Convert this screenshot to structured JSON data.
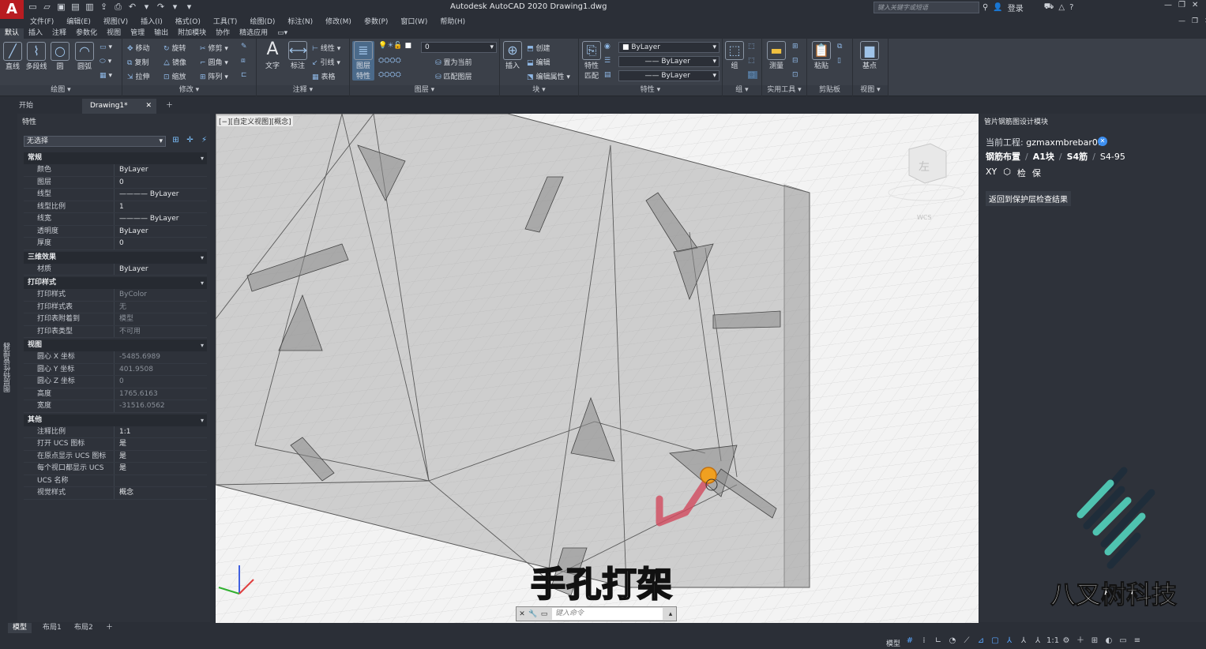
{
  "app": {
    "logo_letter": "A",
    "window_title": "Autodesk AutoCAD 2020   Drawing1.dwg",
    "search_placeholder": "键入关键字或短语",
    "login": "登录",
    "accent_color": "#b81c21"
  },
  "menu": [
    "文件(F)",
    "编辑(E)",
    "视图(V)",
    "插入(I)",
    "格式(O)",
    "工具(T)",
    "绘图(D)",
    "标注(N)",
    "修改(M)",
    "参数(P)",
    "窗口(W)",
    "帮助(H)"
  ],
  "ribbon_tabs": [
    "默认",
    "插入",
    "注释",
    "参数化",
    "视图",
    "管理",
    "输出",
    "附加模块",
    "协作",
    "精选应用"
  ],
  "ribbon": {
    "draw": {
      "title": "绘图",
      "line": "直线",
      "polyline": "多段线",
      "circle": "圆",
      "arc": "圆弧"
    },
    "modify": {
      "title": "修改",
      "move": "移动",
      "rotate": "旋转",
      "trim": "修剪",
      "copy": "复制",
      "mirror": "镜像",
      "fillet": "圆角",
      "stretch": "拉伸",
      "scale": "缩放",
      "array": "阵列"
    },
    "annotation": {
      "title": "注释",
      "text": "文字",
      "dimension": "标注",
      "linear": "线性",
      "leader": "引线",
      "table": "表格"
    },
    "layers": {
      "title": "图层",
      "properties": "图层\n特性",
      "layer_value": "0",
      "set_current": "置为当前",
      "match_layer": "匹配图层"
    },
    "block": {
      "title": "块",
      "insert": "插入",
      "create": "创建",
      "edit": "编辑",
      "edit_attr": "编辑属性"
    },
    "properties": {
      "title": "特性",
      "match": "特性\n匹配",
      "color": "ByLayer",
      "linetype": "ByLayer",
      "lineweight": "ByLayer"
    },
    "groups": {
      "title": "组",
      "group": "组"
    },
    "utilities": {
      "title": "实用工具",
      "measure": "测量"
    },
    "clipboard": {
      "title": "剪贴板",
      "paste": "粘贴"
    },
    "view": {
      "title": "视图",
      "base": "基点"
    }
  },
  "doc_tabs": {
    "start": "开始",
    "drawing": "Drawing1*"
  },
  "properties_panel": {
    "title": "特性",
    "selection": "无选择",
    "sections": [
      {
        "name": "常规",
        "rows": [
          [
            "颜色",
            "ByLayer"
          ],
          [
            "图层",
            "0"
          ],
          [
            "线型",
            "———— ByLayer"
          ],
          [
            "线型比例",
            "1"
          ],
          [
            "线宽",
            "———— ByLayer"
          ],
          [
            "透明度",
            "ByLayer"
          ],
          [
            "厚度",
            "0"
          ]
        ]
      },
      {
        "name": "三维效果",
        "rows": [
          [
            "材质",
            "ByLayer"
          ]
        ]
      },
      {
        "name": "打印样式",
        "rows": [
          [
            "打印样式",
            "ByColor"
          ],
          [
            "打印样式表",
            "无"
          ],
          [
            "打印表附着到",
            "模型"
          ],
          [
            "打印表类型",
            "不可用"
          ]
        ]
      },
      {
        "name": "视图",
        "rows": [
          [
            "圆心 X 坐标",
            "-5485.6989"
          ],
          [
            "圆心 Y 坐标",
            "401.9508"
          ],
          [
            "圆心 Z 坐标",
            "0"
          ],
          [
            "高度",
            "1765.6163"
          ],
          [
            "宽度",
            "-31516.0562"
          ]
        ]
      },
      {
        "name": "其他",
        "rows": [
          [
            "注释比例",
            "1:1"
          ],
          [
            "打开 UCS 图标",
            "是"
          ],
          [
            "在原点显示 UCS 图标",
            "是"
          ],
          [
            "每个视口都显示 UCS",
            "是"
          ],
          [
            "UCS 名称",
            ""
          ],
          [
            "视觉样式",
            "概念"
          ]
        ]
      }
    ],
    "side_label": "图层特性管理器"
  },
  "viewport": {
    "label": "[−][自定义视图][概念]",
    "viewcube_face": "左",
    "wcs": "WCS",
    "subtitle": "手孔打架",
    "command_placeholder": "键入命令"
  },
  "right_panel": {
    "title": "管片钢筋图设计模块",
    "project_label": "当前工程:",
    "project_name": "gzmaxmbrebar01",
    "crumbs": [
      "钢筋布置",
      "A1块",
      "S4筋",
      "S4-95"
    ],
    "tools": [
      "XY",
      "检",
      "保"
    ],
    "back_button": "返回到保护层检查结果",
    "brand": "八叉树科技",
    "brand_color": "#4fc3b0"
  },
  "layout_tabs": [
    "模型",
    "布局1",
    "布局2"
  ],
  "status": {
    "model": "模型",
    "scale": "1:1"
  }
}
